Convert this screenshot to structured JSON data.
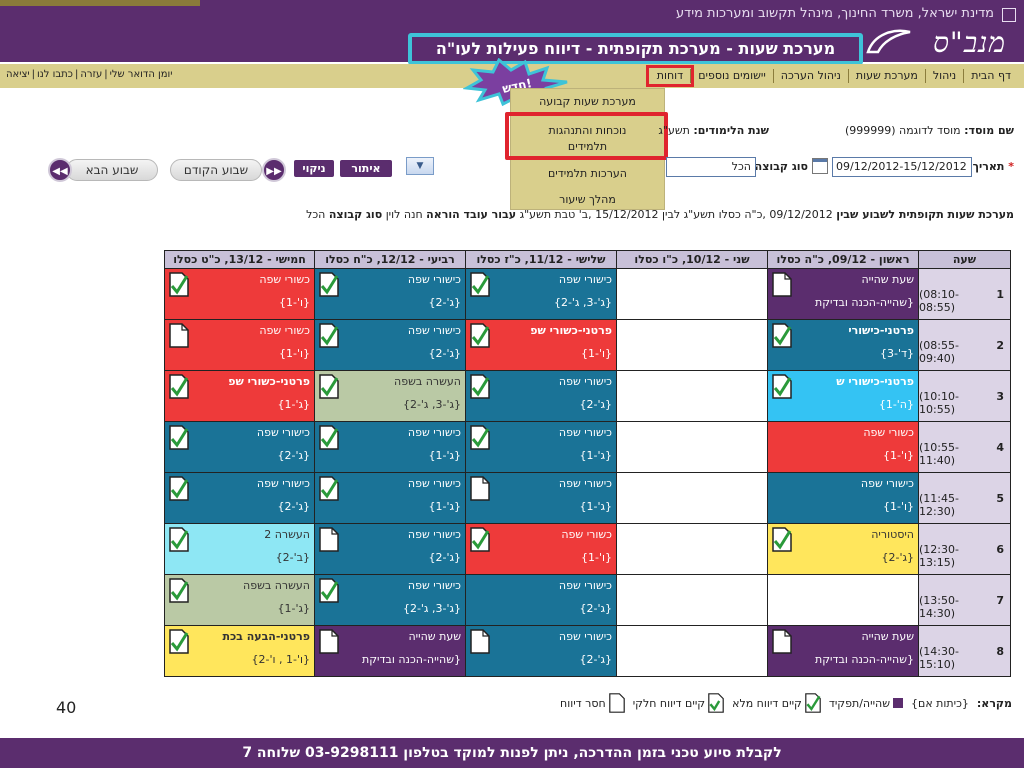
{
  "header": {
    "ministry": "מדינת ישראל, משרד החינוך, מינהל תקשוב ומערכות מידע",
    "logo": "מנב\"ס",
    "page_title": "מערכת שעות - מערכת תקופתית - דיווח פעילות לעו\"ה"
  },
  "nav": {
    "items": [
      "דף הבית",
      "ניהול",
      "מערכת שעות",
      "ניהול הערכה",
      "יישומים נוספים",
      "דוחות"
    ],
    "user_links": [
      "יומן הדואר שלי",
      "עזרה",
      "כתבו לנו",
      "יציאה"
    ],
    "new_badge": "חדש!"
  },
  "dropdown": {
    "items": [
      "מערכת שעות קבועה",
      "נוכחות והתנהגות תלמידים",
      "הערכות תלמידים",
      "מהלך שיעור"
    ]
  },
  "institution": {
    "label": "שם מוסד:",
    "value": "מוסד לדוגמה (999999)",
    "year_label": "שנת הלימודים:",
    "year_value": "תשע\"ג"
  },
  "filters": {
    "date_label": "תאריך:",
    "date_value": "09/12/2012-15/12/2012",
    "group_label": "סוג קבוצה:",
    "group_value": "הכל",
    "reset_label": "ניקוי",
    "search_label": "איתור",
    "prev_week": "שבוע הקודם",
    "next_week": "שבוע הבא"
  },
  "summary": {
    "prefix": "מערכת שעות תקופתית לשבוע שבין",
    "range": "09/12/2012 ,כ\"ה כסלו תשע\"ג לבין 15/12/2012 ,ב' טבת תשע\"ג",
    "teacher_label": "עבור עובד הוראה",
    "teacher": "חנה לוין",
    "group_label": "סוג קבוצה",
    "group": "הכל"
  },
  "grid": {
    "headers": [
      "שעה",
      "ראשון - 09/12, כ\"ה כסלו",
      "שני - 10/12, כ\"ו כסלו",
      "שלישי - 11/12, כ\"ז כסלו",
      "רביעי - 12/12, כ\"ח כסלו",
      "חמישי - 13/12, כ\"ט כסלו"
    ],
    "rows": [
      {
        "num": "1",
        "time": "(08:10-08:55)",
        "cells": [
          {
            "l1": "שעת שהייה",
            "l2": "{שהייה-הכנה ובדיקת",
            "color": "purple",
            "icon": "doc"
          },
          null,
          {
            "l1": "כישורי שפה",
            "l2": "{ג'-3, ג'-2}",
            "color": "teal",
            "icon": "check"
          },
          {
            "l1": "כישורי שפה",
            "l2": "{ג'-2}",
            "color": "teal",
            "icon": "check"
          },
          {
            "l1": "כשורי שפה",
            "l2": "{ו'-1}",
            "color": "red",
            "icon": "check"
          }
        ]
      },
      {
        "num": "2",
        "time": "(08:55-09:40)",
        "cells": [
          {
            "l1": "פרטני-כישורי",
            "l2": "{ד'-3}",
            "color": "teal",
            "icon": "check",
            "bold": true
          },
          null,
          {
            "l1": "פרטני-כשורי שפ",
            "l2": "{ו'-1}",
            "color": "red",
            "icon": "check",
            "bold": true
          },
          {
            "l1": "כישורי שפה",
            "l2": "{ג'-2}",
            "color": "teal",
            "icon": "check"
          },
          {
            "l1": "כשורי שפה",
            "l2": "{ו'-1}",
            "color": "red",
            "icon": "doc"
          }
        ]
      },
      {
        "num": "3",
        "time": "(10:10-10:55)",
        "cells": [
          {
            "l1": "פרטני-כישורי ש",
            "l2": "{ה'-1}",
            "color": "sky",
            "icon": "check",
            "bold": true
          },
          null,
          {
            "l1": "כישורי שפה",
            "l2": "{ג'-2}",
            "color": "teal",
            "icon": "check"
          },
          {
            "l1": "העשרה בשפה",
            "l2": "{ג'-3, ג'-2}",
            "color": "sage",
            "icon": "check"
          },
          {
            "l1": "פרטני-כשורי שפ",
            "l2": "{ג'-1}",
            "color": "red",
            "icon": "check",
            "bold": true
          }
        ]
      },
      {
        "num": "4",
        "time": "(10:55-11:40)",
        "cells": [
          {
            "l1": "כשורי שפה",
            "l2": "{ו'-1}",
            "color": "red",
            "icon": "none"
          },
          null,
          {
            "l1": "כישורי שפה",
            "l2": "{ג'-1}",
            "color": "teal",
            "icon": "check"
          },
          {
            "l1": "כישורי שפה",
            "l2": "{ג'-1}",
            "color": "teal",
            "icon": "check"
          },
          {
            "l1": "כישורי שפה",
            "l2": "{ג'-2}",
            "color": "teal",
            "icon": "check"
          }
        ]
      },
      {
        "num": "5",
        "time": "(11:45-12:30)",
        "cells": [
          {
            "l1": "כישורי שפה",
            "l2": "{ו'-1}",
            "color": "teal",
            "icon": "none"
          },
          null,
          {
            "l1": "כישורי שפה",
            "l2": "{ג'-1}",
            "color": "teal",
            "icon": "doc"
          },
          {
            "l1": "כישורי שפה",
            "l2": "{ג'-1}",
            "color": "teal",
            "icon": "check"
          },
          {
            "l1": "כישורי שפה",
            "l2": "{ג'-2}",
            "color": "teal",
            "icon": "check"
          }
        ]
      },
      {
        "num": "6",
        "time": "(12:30-13:15)",
        "cells": [
          {
            "l1": "היסטוריה",
            "l2": "{ג'-2}",
            "color": "yellow",
            "icon": "check"
          },
          null,
          {
            "l1": "כשורי שפה",
            "l2": "{ו'-1}",
            "color": "red",
            "icon": "check"
          },
          {
            "l1": "כישורי שפה",
            "l2": "{ג'-2}",
            "color": "teal",
            "icon": "doc"
          },
          {
            "l1": "העשרה 2",
            "l2": "{ב'-2}",
            "color": "cyan",
            "icon": "check"
          }
        ]
      },
      {
        "num": "7",
        "time": "(13:50-14:30)",
        "cells": [
          null,
          null,
          {
            "l1": "כישורי שפה",
            "l2": "{ג'-2}",
            "color": "teal",
            "icon": "none"
          },
          {
            "l1": "כישורי שפה",
            "l2": "{ג'-3, ג'-2}",
            "color": "teal",
            "icon": "check"
          },
          {
            "l1": "העשרה בשפה",
            "l2": "{ג'-1}",
            "color": "sage",
            "icon": "check"
          }
        ]
      },
      {
        "num": "8",
        "time": "(14:30-15:10)",
        "cells": [
          {
            "l1": "שעת שהייה",
            "l2": "{שהייה-הכנה ובדיקת",
            "color": "purple",
            "icon": "doc"
          },
          null,
          {
            "l1": "כישורי שפה",
            "l2": "{ג'-2}",
            "color": "teal",
            "icon": "doc"
          },
          {
            "l1": "שעת שהייה",
            "l2": "{שהייה-הכנה ובדיקת",
            "color": "purple",
            "icon": "doc"
          },
          {
            "l1": "פרטני-הבעה בכת",
            "l2": "{ו'-1 , ו'-2}",
            "color": "yellow",
            "icon": "check",
            "bold": true
          }
        ]
      }
    ]
  },
  "legend": {
    "label": "מקרא:",
    "items": [
      "{כיתות אם}",
      "שהייה/תפקיד",
      "קיים דיווח מלא",
      "קיים דיווח חלקי",
      "חסר דיווח"
    ]
  },
  "page_number": "40",
  "footer": "לקבלת סיוע טכני בזמן ההדרכה, ניתן לפנות למוקד בטלפון 03-9298111 שלוחה 7",
  "colors": {
    "purple": "#5b2d6e",
    "teal": "#1a7397",
    "red": "#ee3a3a",
    "highlight": "#e0242e",
    "title_frame": "#3ec3d8",
    "nav": "#d9cf8c"
  }
}
